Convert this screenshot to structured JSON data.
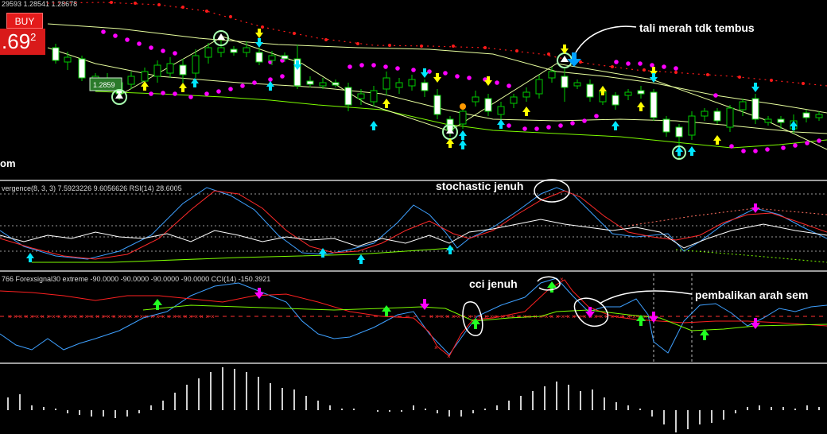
{
  "header": {
    "ohlc_text": "29593 1.28541 1.28678"
  },
  "trade": {
    "buy_label": "BUY",
    "price_big": "69",
    "price_small": "2",
    "price_lead": "."
  },
  "price_panel": {
    "watermark": "om",
    "signal_box_label": "1.2859"
  },
  "stoch_panel": {
    "title": "vergence(8, 3, 3) 7.5923226 9.6056626  RSI(14) 28.6005"
  },
  "cci_panel": {
    "title": "766  Forexsignal30 extreme -90.0000 -90.0000 -90.0000 -90.0000  CCI(14) -150.3921"
  },
  "annotations": {
    "tali_merah": "tali merah tdk tembus",
    "stochastic_jenuh": "stochastic jenuh",
    "cci_jenuh": "cci jenuh",
    "pembalikan": "pembalikan arah sem"
  },
  "colors": {
    "background": "#000000",
    "grid": "#b0b0b0",
    "bull_candle": "#ffffff",
    "bear_candle": "#000000",
    "wick": "#00cc00",
    "envelope": "#e8ff9e",
    "bands": "#7cfc00",
    "red_rope": "#ff1a1a",
    "psar": "#ff00ff",
    "stoch_main": "#3ea0ff",
    "stoch_signal": "#ff2a2a",
    "rsi": "#ffffff",
    "cci": "#3ea0ff",
    "arrow_cyan": "#00e5ff",
    "arrow_yellow": "#ffff00",
    "arrow_green": "#22ff22",
    "arrow_magenta": "#ff00ff",
    "histogram": "#cfcfcf",
    "buy_button": "#e41b1b"
  }
}
